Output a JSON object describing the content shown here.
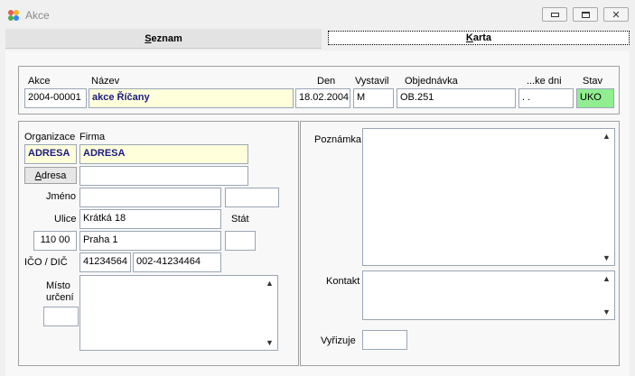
{
  "window": {
    "title": "Akce",
    "icon": "app-flower-icon",
    "minimize_glyph": "▭",
    "maximize_glyph": "□",
    "close_glyph": "✕"
  },
  "tabs": [
    {
      "label": "Seznam",
      "underline": "S",
      "rest": "eznam"
    },
    {
      "label": "Karta",
      "underline": "K",
      "rest": "arta"
    }
  ],
  "header": {
    "labels": {
      "akce": "Akce",
      "nazev": "Název",
      "den": "Den",
      "vystavil": "Vystavil",
      "objednavka": "Objednávka",
      "dni": "...ke dni",
      "stav": "Stav"
    },
    "values": {
      "akce": "2004-00001",
      "nazev": "akce Říčany",
      "den": "18.02.2004",
      "vystavil": "M",
      "objednavka": "OB.251",
      "dni": ". .",
      "stav": "UKO"
    }
  },
  "left": {
    "organizace_label": "Organizace",
    "firma_label": "Firma",
    "organizace_value": "ADRESA",
    "firma_value": "ADRESA",
    "adresa_button": "Adresa",
    "adresa_underline": "A",
    "adresa_rest": "dresa",
    "adresa_value": "",
    "jmeno_label": "Jméno",
    "jmeno_value": "",
    "jmeno_extra": "",
    "ulice_label": "Ulice",
    "ulice_value": "Krátká 18",
    "stat_label": "Stát",
    "stat_value": "",
    "psc_value": "110 00",
    "mesto_value": "Praha 1",
    "ico_label": "IČO / DIČ",
    "ico_value": "41234564",
    "dic_value": "002-41234464",
    "misto_label_1": "Místo",
    "misto_label_2": "určení",
    "misto_code": "",
    "misto_text": ""
  },
  "right": {
    "poznamka_label": "Poznámka",
    "poznamka_value": "",
    "kontakt_label": "Kontakt",
    "kontakt_value": "",
    "vyrizuje_label": "Vyřizuje",
    "vyrizuje_value": ""
  },
  "scroll": {
    "up": "▲",
    "down": "▼"
  }
}
